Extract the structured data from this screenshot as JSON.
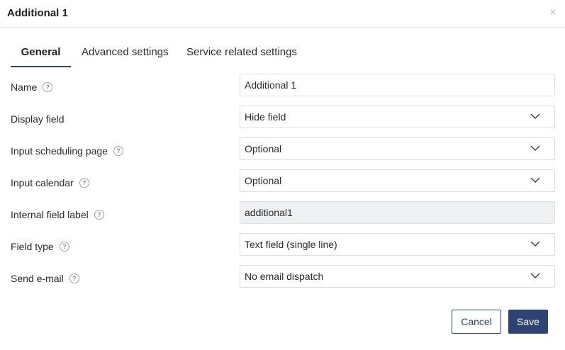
{
  "dialog": {
    "title": "Additional 1",
    "close_glyph": "×"
  },
  "tabs": [
    {
      "label": "General",
      "active": true
    },
    {
      "label": "Advanced settings",
      "active": false
    },
    {
      "label": "Service related settings",
      "active": false
    }
  ],
  "fields": {
    "name": {
      "label": "Name",
      "value": "Additional 1",
      "has_help": true
    },
    "display_field": {
      "label": "Display field",
      "value": "Hide field"
    },
    "input_scheduling_page": {
      "label": "Input scheduling page",
      "value": "Optional",
      "has_help": true
    },
    "input_calendar": {
      "label": "Input calendar",
      "value": "Optional",
      "has_help": true
    },
    "internal_field_label": {
      "label": "Internal field label",
      "value": "additional1",
      "has_help": true
    },
    "field_type": {
      "label": "Field type",
      "value": "Text field (single line)",
      "has_help": true
    },
    "send_email": {
      "label": "Send e-mail",
      "value": "No email dispatch",
      "has_help": true
    }
  },
  "help_glyph": "?",
  "buttons": {
    "cancel": "Cancel",
    "save": "Save"
  },
  "colors": {
    "accent": "#2d4373",
    "readonly_bg": "#eef0f2",
    "border": "#dcdfe3"
  },
  "icons": {
    "help": "question-circle-icon",
    "dropdown": "chevron-down-icon",
    "close": "close-icon"
  }
}
